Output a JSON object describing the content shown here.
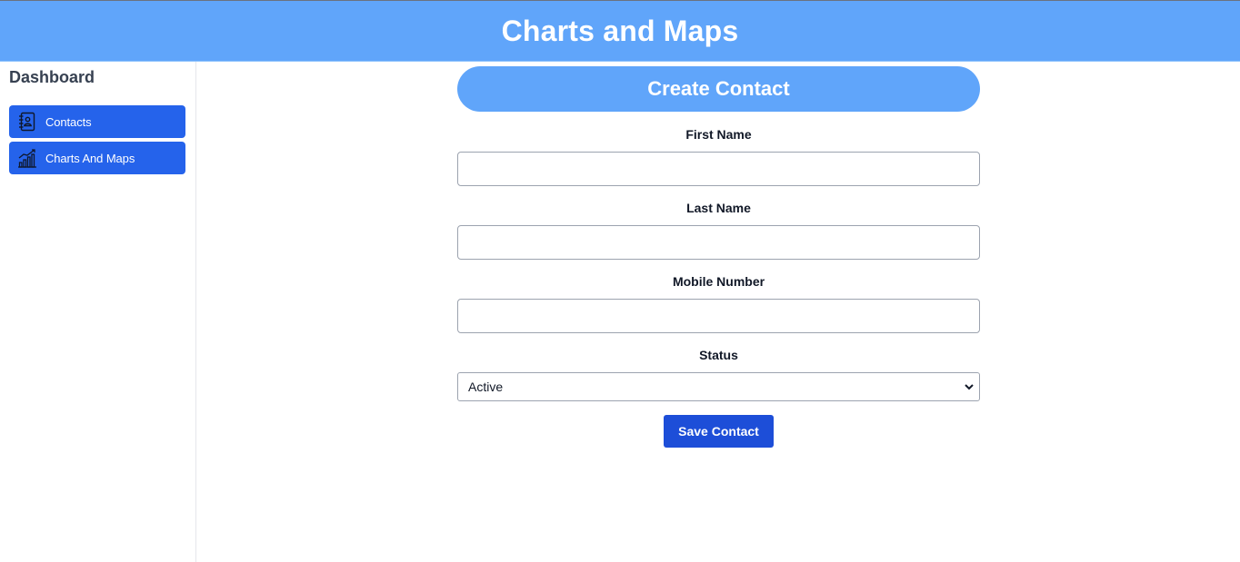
{
  "header": {
    "title": "Charts and Maps"
  },
  "sidebar": {
    "title": "Dashboard",
    "items": [
      {
        "label": "Contacts",
        "icon": "contacts-book-icon"
      },
      {
        "label": "Charts And Maps",
        "icon": "chart-trend-icon"
      }
    ]
  },
  "form": {
    "title": "Create Contact",
    "first_name": {
      "label": "First Name",
      "value": ""
    },
    "last_name": {
      "label": "Last Name",
      "value": ""
    },
    "mobile_number": {
      "label": "Mobile Number",
      "value": ""
    },
    "status": {
      "label": "Status",
      "selected": "Active"
    },
    "save_label": "Save Contact"
  },
  "colors": {
    "header_bg": "#60a5fa",
    "nav_item_bg": "#2563eb",
    "save_button_bg": "#1d4ed8"
  }
}
